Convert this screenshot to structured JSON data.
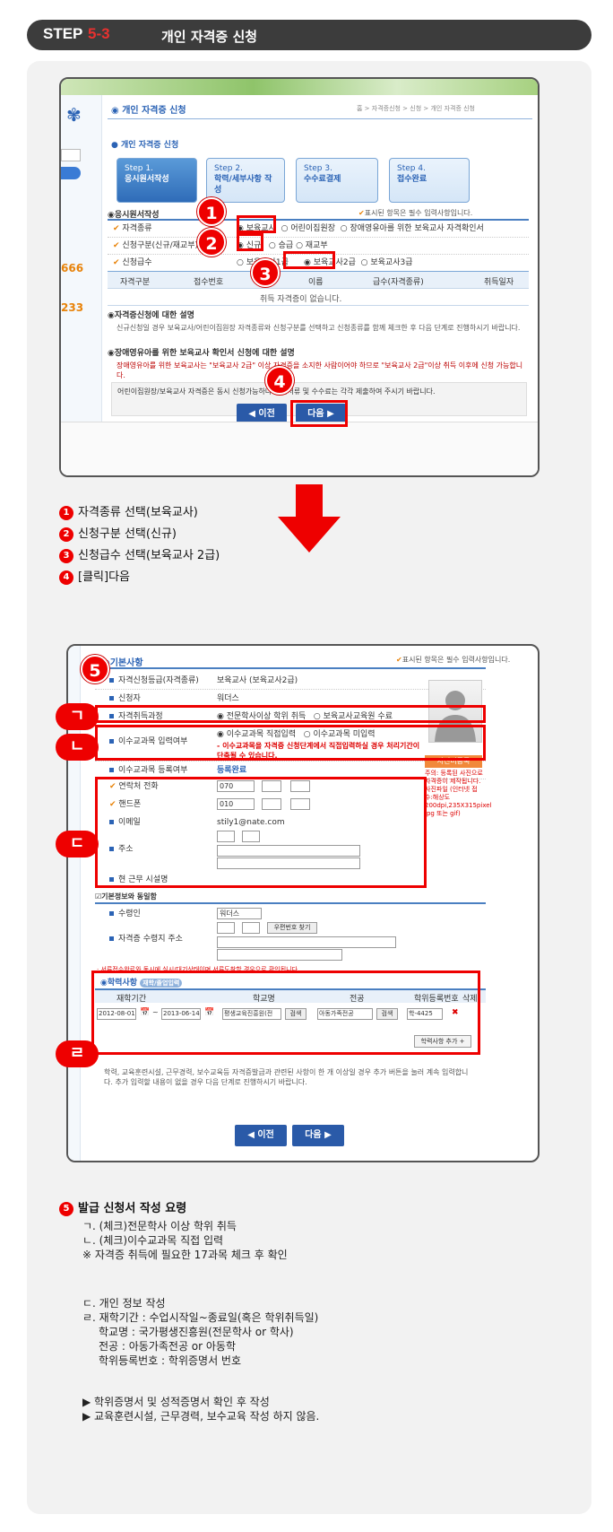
{
  "header": {
    "step_label": "STEP",
    "step_num": "5-3",
    "title": "개인 자격증 신청"
  },
  "shot1": {
    "page_title": "개인 자격증 신청",
    "breadcrumb": "홈 > 자격증신청 > 신청 > 개인 자격증 신청",
    "section_title": "개인 자격증 신청",
    "steps": [
      {
        "label": "Step 1.",
        "name": "응시원서작성"
      },
      {
        "label": "Step 2.",
        "name": "학력/세부사항 작성"
      },
      {
        "label": "Step 3.",
        "name": "수수료결제"
      },
      {
        "label": "Step 4.",
        "name": "접수완료"
      }
    ],
    "left_nums": [
      "666",
      "233"
    ],
    "form_title": "응시원서작성",
    "required_note": "표시된 항목은 필수 입력사항입니다.",
    "rows": [
      {
        "label": "자격종류",
        "options": [
          "보육교사",
          "어린이집원장",
          "장애영유아를 위한 보육교사 자격확인서"
        ]
      },
      {
        "label": "신청구분(신규/재교부)",
        "options": [
          "신규",
          "승급",
          "재교부"
        ]
      },
      {
        "label": "신청급수",
        "options": [
          "보육교사1급",
          "보육교사2급",
          "보육교사3급"
        ]
      }
    ],
    "table_headers": [
      "자격구분",
      "접수번호",
      "이름",
      "급수(자격종류)",
      "취득일자"
    ],
    "table_empty": "취득 자격증이 없습니다.",
    "info1_title": "자격증신청에 대한 설명",
    "info1_text": "신규신청일 경우 보육교사/어린이집원장 자격종류와 신청구분를 선택하고 신청종류를 함께 체크한 후 다음 단계로 진행하시기 바랍니다.",
    "info2_title": "장애영유아를 위한 보육교사 확인서 신청에 대한 설명",
    "info2_text": "장애영유아를 위한 보육교사는 \"보육교사 2급\" 이상 자격증을 소지한 사람이어야 하므로 \"보육교사 2급\"이상 취득 이후에 신청 가능합니다.",
    "info3_text": "어린이집원장/보육교사 자격증은 동시 신청가능하나 구비서류 및 수수료는 각각 제출하여 주시기 바랍니다.",
    "prev_button": "◀ 이전",
    "next_button": "다음 ▶",
    "badges": [
      "1",
      "2",
      "3",
      "4"
    ]
  },
  "legend1": [
    {
      "num": "1",
      "text": "자격종류 선택(보육교사)"
    },
    {
      "num": "2",
      "text": "신청구분 선택(신규)"
    },
    {
      "num": "3",
      "text": "신청급수 선택(보육교사 2급)"
    },
    {
      "num": "4",
      "text": "[클릭]다음"
    }
  ],
  "shot2": {
    "section_title": "기본사항",
    "required_note": "표시된 항목은 필수 입력사항입니다.",
    "badge5": "5",
    "rows": [
      {
        "label": "자격신청등급(자격종류)",
        "value": "보육교사 (보육교사2급)"
      },
      {
        "label": "신청자",
        "value": "워더스"
      },
      {
        "label": "자격취득과정",
        "value": "전문학사이상 학위 취득",
        "value2": "보육교사교육원 수료"
      },
      {
        "label": "이수교과목 입력여부",
        "value": "이수교과목 직접입력",
        "value2": "이수교과목 미입력",
        "warn": "- 이수교과목을 자격증 신청단계에서 직접입력하실 경우 처리기간이 단축될 수 있습니다."
      },
      {
        "label": "이수교과목 등록여부",
        "value": "등록완료"
      },
      {
        "label": "연락처 전화",
        "value": "070"
      },
      {
        "label": "핸드폰",
        "value": "010"
      },
      {
        "label": "이메일",
        "value": "stily1@nate.com"
      },
      {
        "label": "주소",
        "value": ""
      },
      {
        "label": "현 근무 시설명",
        "value": ""
      }
    ],
    "photo_button": "사진미등록",
    "photo_note": "주의: 등록된 사진으로 자격증이 제작됩니다. 사진파일 (인터넷 접수:해상도 200dpi,235X315pixel jpg 또는 gif)",
    "same_as_basic": "기본정보와 동일함",
    "receiver_label": "수령인",
    "receiver_value": "워더스",
    "addr_label": "자격증 수령지 주소",
    "zip_button": "우편번호 찾기",
    "red_note": "· 서류접수완료와 동시에 실시/대기상태이며 서류도착할 경우으로 확인됩니다.",
    "edu_title": "학력사항",
    "edu_badge": "재학/졸업입력",
    "edu_headers": [
      "재학기간",
      "학교명",
      "전공",
      "학위등록번호",
      "삭제"
    ],
    "edu_row": {
      "start": "2012-08-01",
      "tilde": "~",
      "end": "2013-06-14",
      "school": "평생교육진흥원(전",
      "major": "아동가족전공",
      "degree": "학-4425",
      "search": "검색"
    },
    "add_button": "학력사항 추가 +",
    "footnote": "학력, 교육훈련시설, 근무경력, 보수교육등 자격증발급과 관련된 사항이 한 개 이상일 경우 추가 버튼을 눌러 계속 입력합니다. 추가 입력할 내용이 없을 경우 다음 단계로 진행하시기 바랍니다.",
    "prev_button": "◀ 이전",
    "next_button": "다음 ▶",
    "marks": [
      "ㄱ",
      "ㄴ",
      "ㄷ",
      "ㄹ"
    ]
  },
  "legend2": {
    "num": "5",
    "title": "발급 신청서 작성 요령",
    "lines": [
      "ㄱ. (체크)전문학사 이상 학위 취득",
      "ㄴ. (체크)이수교과목 직접 입력",
      "※ 자격증 취득에 필요한 17과목 체크 후 확인",
      "ㄷ. 개인 정보 작성",
      "ㄹ. 재학기간 : 수업시작일~종료일(혹은 학위취득일)",
      "학교명 : 국가평생진흥원(전문학사 or 학사)",
      "전공 : 아동가족전공 or 아동학",
      "학위등록번호 : 학위증명서 번호",
      "▶ 학위증명서 및 성적증명서 확인 후 작성",
      "▶ 교육훈련시설, 근무경력, 보수교육 작성 하지 않음."
    ]
  },
  "colors": {
    "accent": "#e00000",
    "brand_blue": "#2b63b5",
    "btn_blue": "#2a5aa8",
    "header_bg": "#3c3c3c"
  }
}
